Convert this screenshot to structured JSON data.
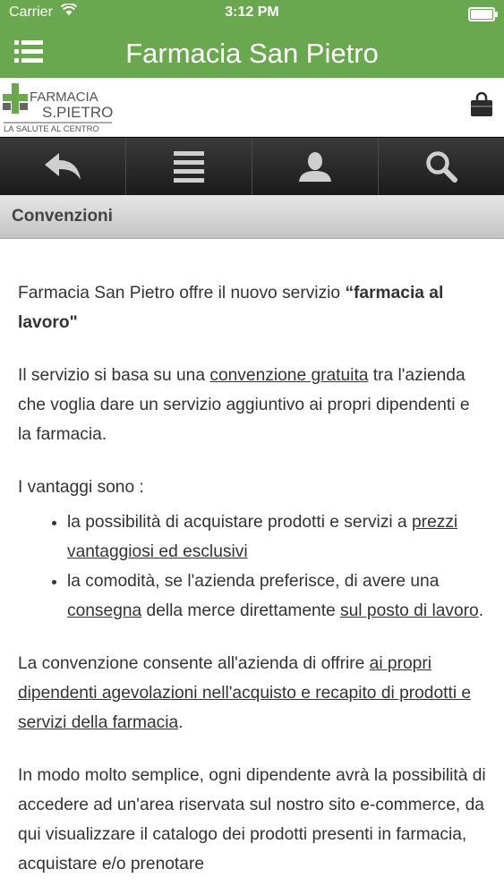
{
  "status": {
    "carrier": "Carrier",
    "time": "3:12 PM"
  },
  "header": {
    "title": "Farmacia San Pietro",
    "menu_icon": "hamburger-menu-icon"
  },
  "logo": {
    "line1": "FARMACIA",
    "line2": "S.PIETRO",
    "tagline": "LA SALUTE AL CENTRO"
  },
  "toolbar": {
    "icons": [
      "back-icon",
      "list-icon",
      "user-icon",
      "search-icon"
    ]
  },
  "section": {
    "title": "Convenzioni"
  },
  "content": {
    "p1_text": "Farmacia San Pietro offre il nuovo servizio ",
    "p1_bold": "“farmacia al lavoro\"",
    "p2_before": "Il servizio si basa su una ",
    "p2_link": "convenzione gratuita",
    "p2_after": " tra l'azienda che voglia dare un servizio aggiuntivo ai propri dipendenti e la farmacia.",
    "p3": "I vantaggi sono :",
    "li1_before": "la possibilità di acquistare prodotti e servizi a ",
    "li1_link": "prezzi vantaggiosi ed esclusivi",
    "li2_before": "la comodità, se l'azienda preferisce, di avere una ",
    "li2_link1": "consegna",
    "li2_mid": " della merce direttamente ",
    "li2_link2": "sul posto di lavoro",
    "li2_after": ".",
    "p4_before": "La convenzione consente all'azienda di offrire ",
    "p4_link": "ai propri dipendenti agevolazioni nell'acquisto e recapito di prodotti e servizi della farmacia",
    "p4_after": ".",
    "p5": "In modo molto semplice, ogni dipendente avrà la possibilità di accedere ad un'area riservata sul nostro sito e-commerce, da qui visualizzare il catalogo dei prodotti presenti in farmacia, acquistare e/o prenotare"
  },
  "colors": {
    "brand_green": "#6aa84f",
    "toolbar_dark": "#222222"
  }
}
